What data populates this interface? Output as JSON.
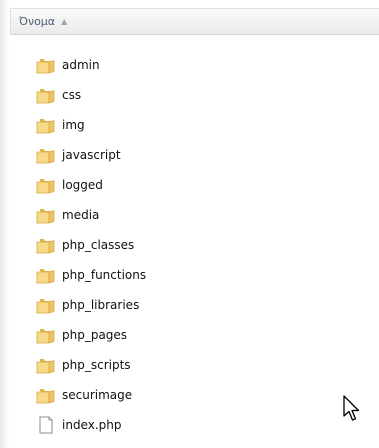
{
  "header": {
    "column_name": "Όνομα",
    "sort_indicator": "▲"
  },
  "items": [
    {
      "name": "admin",
      "type": "folder"
    },
    {
      "name": "css",
      "type": "folder"
    },
    {
      "name": "img",
      "type": "folder"
    },
    {
      "name": "javascript",
      "type": "folder"
    },
    {
      "name": "logged",
      "type": "folder"
    },
    {
      "name": "media",
      "type": "folder"
    },
    {
      "name": "php_classes",
      "type": "folder"
    },
    {
      "name": "php_functions",
      "type": "folder"
    },
    {
      "name": "php_libraries",
      "type": "folder"
    },
    {
      "name": "php_pages",
      "type": "folder"
    },
    {
      "name": "php_scripts",
      "type": "folder"
    },
    {
      "name": "securimage",
      "type": "folder"
    },
    {
      "name": "index.php",
      "type": "file"
    }
  ],
  "icons": {
    "folder": "folder-icon",
    "file": "document-icon",
    "cursor": "mouse-pointer-icon"
  },
  "colors": {
    "folder_light": "#f7d98a",
    "folder_dark": "#e2b54c",
    "header_text": "#4c607a"
  }
}
